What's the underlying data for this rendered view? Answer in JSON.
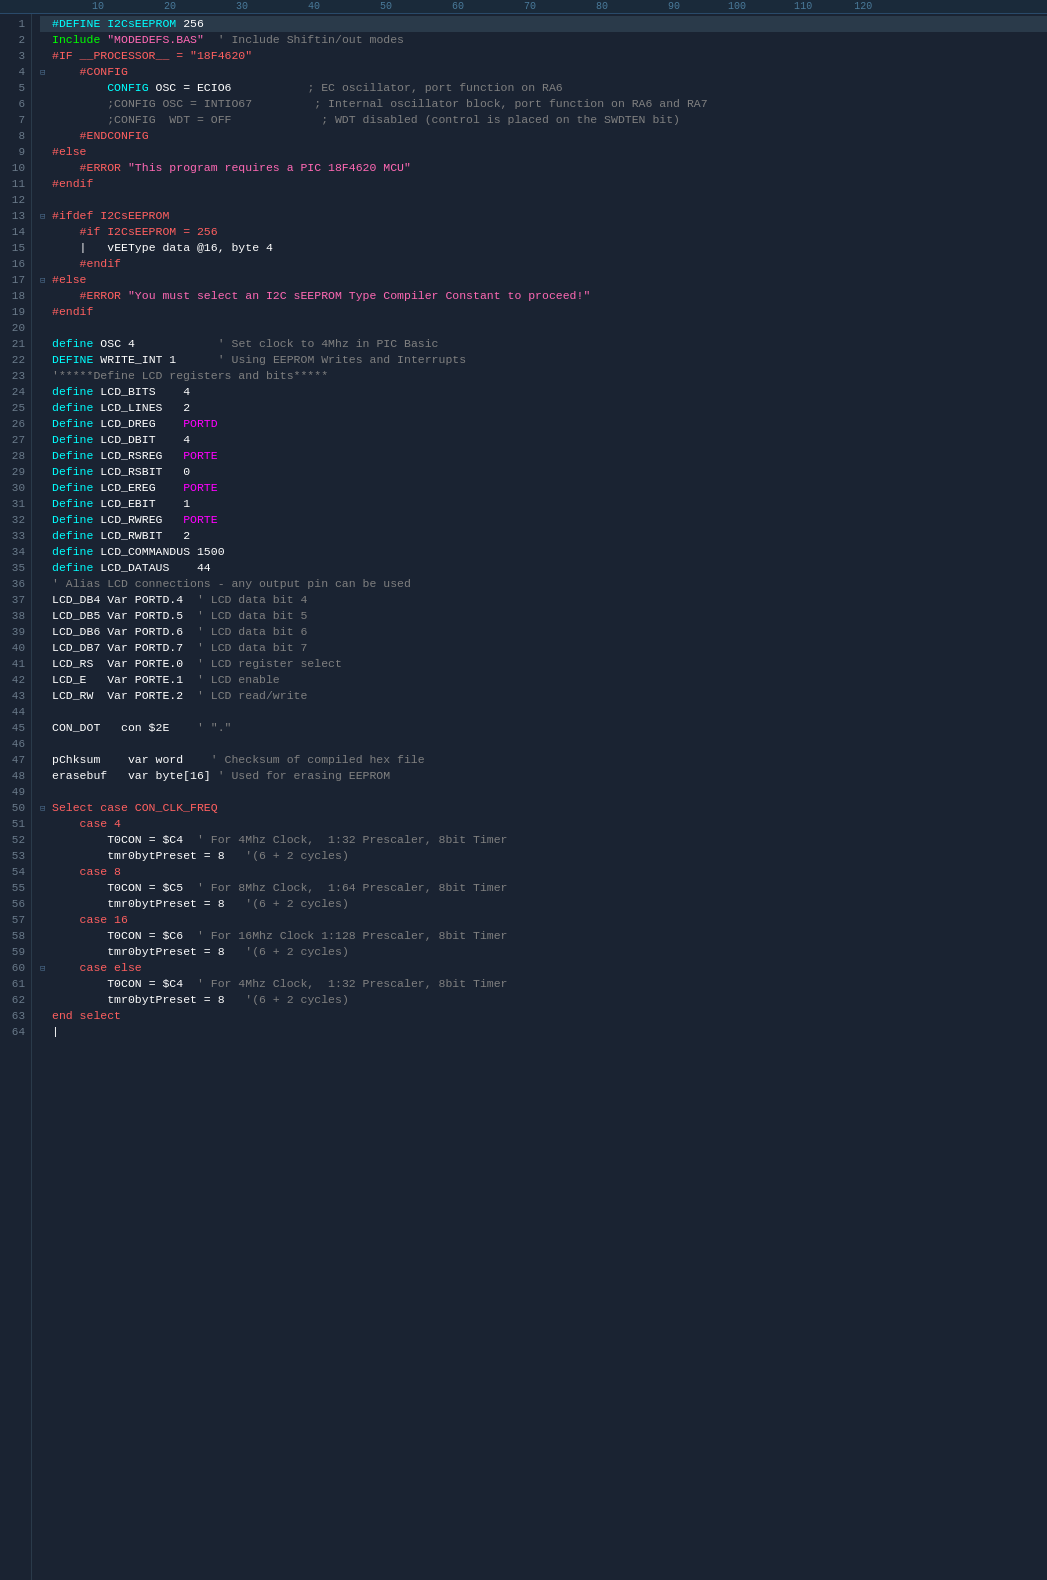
{
  "ruler": {
    "markers": [
      "10",
      "20",
      "30",
      "40",
      "50",
      "60",
      "70",
      "80",
      "90",
      "100",
      "110",
      "120"
    ]
  },
  "lines": [
    {
      "num": 1,
      "fold": "none",
      "content": "<span class='kw-define'>#DEFINE I2CsEEPROM</span> <span class='num-val'>256</span>",
      "highlight": true
    },
    {
      "num": 2,
      "fold": "none",
      "content": "<span class='kw-include'>Include</span> <span class='str-val'>\"MODEDEFS.BAS\"</span>  <span class='comment'>' Include Shiftin/out modes</span>"
    },
    {
      "num": 3,
      "fold": "none",
      "content": "<span class='kw-if'>#IF __PROCESSOR__ = \"18F4620\"</span>"
    },
    {
      "num": 4,
      "fold": "open",
      "content": "    <span class='kw-config'>#CONFIG</span>"
    },
    {
      "num": 5,
      "fold": "none",
      "content": "        <span class='label-cyan'>CONFIG</span> <span class='str-white'>OSC = ECIO6</span>           <span class='comment'>; EC oscillator, port function on RA6</span>"
    },
    {
      "num": 6,
      "fold": "none",
      "content": "        <span class='comment'>;CONFIG OSC = INTIO67         ; Internal oscillator block, port function on RA6 and RA7</span>"
    },
    {
      "num": 7,
      "fold": "none",
      "content": "        <span class='comment'>;CONFIG  WDT = OFF             ; WDT disabled (control is placed on the SWDTEN bit)</span>"
    },
    {
      "num": 8,
      "fold": "none",
      "content": "    <span class='kw-config'>#ENDCONFIG</span>"
    },
    {
      "num": 9,
      "fold": "none",
      "content": "<span class='kw-if'>#else</span>"
    },
    {
      "num": 10,
      "fold": "none",
      "content": "    <span class='kw-error'>#ERROR</span> <span class='str-val'>\"This program requires a PIC 18F4620 MCU\"</span>"
    },
    {
      "num": 11,
      "fold": "none",
      "content": "<span class='kw-if'>#endif</span>"
    },
    {
      "num": 12,
      "fold": "none",
      "content": ""
    },
    {
      "num": 13,
      "fold": "open",
      "content": "<span class='kw-if'>#ifdef I2CsEEPROM</span>"
    },
    {
      "num": 14,
      "fold": "none",
      "content": "    <span class='kw-if'>#if I2CsEEPROM = 256</span>"
    },
    {
      "num": 15,
      "fold": "none",
      "content": "    <span class='op-white'>|</span>   <span class='str-white'>vEEType data @16, byte 4</span>"
    },
    {
      "num": 16,
      "fold": "none",
      "content": "    <span class='kw-if'>#endif</span>"
    },
    {
      "num": 17,
      "fold": "open",
      "content": "<span class='kw-if'>#else</span>"
    },
    {
      "num": 18,
      "fold": "none",
      "content": "    <span class='kw-error'>#ERROR</span> <span class='str-val'>\"You must select an I2C sEEPROM Type Compiler Constant to proceed!\"</span>"
    },
    {
      "num": 19,
      "fold": "none",
      "content": "<span class='kw-if'>#endif</span>"
    },
    {
      "num": 20,
      "fold": "none",
      "content": ""
    },
    {
      "num": 21,
      "fold": "none",
      "content": "<span class='kw-define'>define</span> <span class='str-white'>OSC 4</span>            <span class='comment'>' Set clock to 4Mhz in PIC Basic</span>"
    },
    {
      "num": 22,
      "fold": "none",
      "content": "<span class='kw-define'>DEFINE</span> <span class='str-white'>WRITE_INT 1</span>      <span class='comment'>' Using EEPROM Writes and Interrupts</span>"
    },
    {
      "num": 23,
      "fold": "none",
      "content": "<span class='comment'>'*****Define LCD registers and bits*****</span>"
    },
    {
      "num": 24,
      "fold": "none",
      "content": "<span class='kw-define'>define</span> <span class='str-white'>LCD_BITS    4</span>"
    },
    {
      "num": 25,
      "fold": "none",
      "content": "<span class='kw-define'>define</span> <span class='str-white'>LCD_LINES   2</span>"
    },
    {
      "num": 26,
      "fold": "none",
      "content": "<span class='kw-define'>Define</span> <span class='str-white'>LCD_DREG    </span><span class='port-val'>PORTD</span>"
    },
    {
      "num": 27,
      "fold": "none",
      "content": "<span class='kw-define'>Define</span> <span class='str-white'>LCD_DBIT    4</span>"
    },
    {
      "num": 28,
      "fold": "none",
      "content": "<span class='kw-define'>Define</span> <span class='str-white'>LCD_RSREG   </span><span class='port-val'>PORTE</span>"
    },
    {
      "num": 29,
      "fold": "none",
      "content": "<span class='kw-define'>Define</span> <span class='str-white'>LCD_RSBIT   0</span>"
    },
    {
      "num": 30,
      "fold": "none",
      "content": "<span class='kw-define'>Define</span> <span class='str-white'>LCD_EREG    </span><span class='port-val'>PORTE</span>"
    },
    {
      "num": 31,
      "fold": "none",
      "content": "<span class='kw-define'>Define</span> <span class='str-white'>LCD_EBIT    1</span>"
    },
    {
      "num": 32,
      "fold": "none",
      "content": "<span class='kw-define'>Define</span> <span class='str-white'>LCD_RWREG   </span><span class='port-val'>PORTE</span>"
    },
    {
      "num": 33,
      "fold": "none",
      "content": "<span class='kw-define'>define</span> <span class='str-white'>LCD_RWBIT   2</span>"
    },
    {
      "num": 34,
      "fold": "none",
      "content": "<span class='kw-define'>define</span> <span class='str-white'>LCD_COMMANDUS 1500</span>"
    },
    {
      "num": 35,
      "fold": "none",
      "content": "<span class='kw-define'>define</span> <span class='str-white'>LCD_DATAUS    44</span>"
    },
    {
      "num": 36,
      "fold": "none",
      "content": "<span class='comment'>' Alias LCD connections - any output pin can be used</span>"
    },
    {
      "num": 37,
      "fold": "none",
      "content": "<span class='str-white'>LCD_DB4 Var PORTD.4</span>  <span class='comment'>' LCD data bit 4</span>"
    },
    {
      "num": 38,
      "fold": "none",
      "content": "<span class='str-white'>LCD_DB5 Var PORTD.5</span>  <span class='comment'>' LCD data bit 5</span>"
    },
    {
      "num": 39,
      "fold": "none",
      "content": "<span class='str-white'>LCD_DB6 Var PORTD.6</span>  <span class='comment'>' LCD data bit 6</span>"
    },
    {
      "num": 40,
      "fold": "none",
      "content": "<span class='str-white'>LCD_DB7 Var PORTD.7</span>  <span class='comment'>' LCD data bit 7</span>"
    },
    {
      "num": 41,
      "fold": "none",
      "content": "<span class='str-white'>LCD_RS  Var PORTE.0</span>  <span class='comment'>' LCD register select</span>"
    },
    {
      "num": 42,
      "fold": "none",
      "content": "<span class='str-white'>LCD_E   Var PORTE.1</span>  <span class='comment'>' LCD enable</span>"
    },
    {
      "num": 43,
      "fold": "none",
      "content": "<span class='str-white'>LCD_RW  Var PORTE.2</span>  <span class='comment'>' LCD read/write</span>"
    },
    {
      "num": 44,
      "fold": "none",
      "content": ""
    },
    {
      "num": 45,
      "fold": "none",
      "content": "<span class='str-white'>CON_DOT   con $2E</span>    <span class='comment'>' \".\"</span>"
    },
    {
      "num": 46,
      "fold": "none",
      "content": ""
    },
    {
      "num": 47,
      "fold": "none",
      "content": "<span class='str-white'>pChksum    var word</span>    <span class='comment'>' Checksum of compiled hex file</span>"
    },
    {
      "num": 48,
      "fold": "none",
      "content": "<span class='str-white'>erasebuf   var byte[16]</span> <span class='comment'>' Used for erasing EEPROM</span>"
    },
    {
      "num": 49,
      "fold": "none",
      "content": ""
    },
    {
      "num": 50,
      "fold": "open",
      "content": "<span class='kw-case'>Select case CON_CLK_FREQ</span>"
    },
    {
      "num": 51,
      "fold": "none",
      "content": "    <span class='kw-case'>case 4</span>"
    },
    {
      "num": 52,
      "fold": "none",
      "content": "        <span class='str-white'>T0CON = $C4</span>  <span class='comment'>' For 4Mhz Clock,  1:32 Prescaler, 8bit Timer</span>"
    },
    {
      "num": 53,
      "fold": "none",
      "content": "        <span class='str-white'>tmr0bytPreset = 8</span>   <span class='comment'>'(6 + 2 cycles)</span>"
    },
    {
      "num": 54,
      "fold": "none",
      "content": "    <span class='kw-case'>case 8</span>"
    },
    {
      "num": 55,
      "fold": "none",
      "content": "        <span class='str-white'>T0CON = $C5</span>  <span class='comment'>' For 8Mhz Clock,  1:64 Prescaler, 8bit Timer</span>"
    },
    {
      "num": 56,
      "fold": "none",
      "content": "        <span class='str-white'>tmr0bytPreset = 8</span>   <span class='comment'>'(6 + 2 cycles)</span>"
    },
    {
      "num": 57,
      "fold": "none",
      "content": "    <span class='kw-case'>case 16</span>"
    },
    {
      "num": 58,
      "fold": "none",
      "content": "        <span class='str-white'>T0CON = $C6</span>  <span class='comment'>' For 16Mhz Clock 1:128 Prescaler, 8bit Timer</span>"
    },
    {
      "num": 59,
      "fold": "none",
      "content": "        <span class='str-white'>tmr0bytPreset = 8</span>   <span class='comment'>'(6 + 2 cycles)</span>"
    },
    {
      "num": 60,
      "fold": "open",
      "content": "    <span class='kw-case'>case else</span>"
    },
    {
      "num": 61,
      "fold": "none",
      "content": "        <span class='str-white'>T0CON = $C4</span>  <span class='comment'>' For 4Mhz Clock,  1:32 Prescaler, 8bit Timer</span>"
    },
    {
      "num": 62,
      "fold": "none",
      "content": "        <span class='str-white'>tmr0bytPreset = 8</span>   <span class='comment'>'(6 + 2 cycles)</span>"
    },
    {
      "num": 63,
      "fold": "none",
      "content": "<span class='kw-case'>end select</span>"
    },
    {
      "num": 64,
      "fold": "none",
      "content": "<span class='op-white'>|</span>"
    }
  ]
}
